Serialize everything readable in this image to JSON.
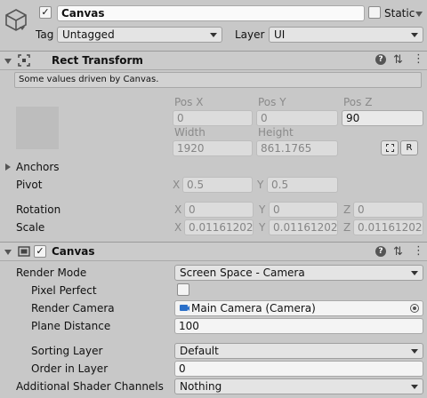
{
  "top": {
    "object_name": "Canvas",
    "static_label": "Static",
    "tag_label": "Tag",
    "tag_value": "Untagged",
    "layer_label": "Layer",
    "layer_value": "UI"
  },
  "rect_transform": {
    "title": "Rect Transform",
    "info": "Some values driven by Canvas.",
    "pos_x_label": "Pos X",
    "pos_y_label": "Pos Y",
    "pos_z_label": "Pos Z",
    "pos_x": "0",
    "pos_y": "0",
    "pos_z": "90",
    "width_label": "Width",
    "height_label": "Height",
    "width": "1920",
    "height": "861.1765",
    "raw_button": "R",
    "anchors_label": "Anchors",
    "pivot_label": "Pivot",
    "pivot_x_label": "X",
    "pivot_x": "0.5",
    "pivot_y_label": "Y",
    "pivot_y": "0.5",
    "rotation_label": "Rotation",
    "rot_x_label": "X",
    "rot_x": "0",
    "rot_y_label": "Y",
    "rot_y": "0",
    "rot_z_label": "Z",
    "rot_z": "0",
    "scale_label": "Scale",
    "scale_x_label": "X",
    "scale_x": "0.01161202",
    "scale_y_label": "Y",
    "scale_y": "0.01161202",
    "scale_z_label": "Z",
    "scale_z": "0.01161202"
  },
  "canvas": {
    "title": "Canvas",
    "render_mode_label": "Render Mode",
    "render_mode_value": "Screen Space - Camera",
    "pixel_perfect_label": "Pixel Perfect",
    "render_camera_label": "Render Camera",
    "render_camera_value": "Main Camera (Camera)",
    "plane_distance_label": "Plane Distance",
    "plane_distance_value": "100",
    "sorting_layer_label": "Sorting Layer",
    "sorting_layer_value": "Default",
    "order_in_layer_label": "Order in Layer",
    "order_in_layer_value": "0",
    "shader_channels_label": "Additional Shader Channels",
    "shader_channels_value": "Nothing"
  },
  "colors": {
    "background": "#c8c8c8",
    "header": "#cbcbcb",
    "field": "#f4f4f4",
    "field_disabled": "#dcdcdc",
    "camera_icon": "#2a6fc9"
  },
  "icons": [
    "gameobject-cube-icon",
    "rect-transform-icon",
    "canvas-component-icon",
    "help-icon",
    "preset-icon",
    "more-icon",
    "camera-icon",
    "object-picker-icon",
    "blueprint-icon"
  ]
}
